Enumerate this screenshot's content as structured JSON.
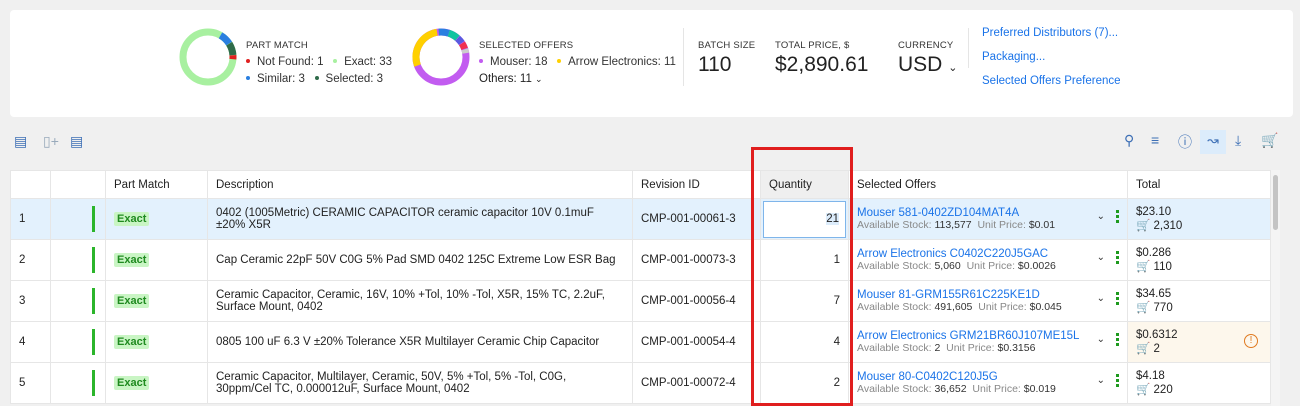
{
  "summary": {
    "part_match": {
      "title": "PART MATCH",
      "items": [
        {
          "label": "Not Found: 1",
          "color": "#e02020"
        },
        {
          "label": "Exact: 33",
          "color": "#a8f0a0"
        },
        {
          "label": "Similar: 3",
          "color": "#2a7fe0"
        },
        {
          "label": "Selected: 3",
          "color": "#2f6b4a"
        }
      ]
    },
    "selected_offers": {
      "title": "SELECTED OFFERS",
      "items": [
        {
          "label": "Mouser: 18",
          "color": "#c25cf0"
        },
        {
          "label": "Arrow Electronics: 11",
          "color": "#ffd000"
        }
      ],
      "others": "Others: 11"
    },
    "batch_size": {
      "label": "BATCH SIZE",
      "value": "110"
    },
    "total_price": {
      "label": "TOTAL PRICE, $",
      "value": "$2,890.61"
    },
    "currency": {
      "label": "CURRENCY",
      "value": "USD"
    },
    "links": [
      "Preferred Distributors (7)...",
      "Packaging...",
      "Selected Offers Preference"
    ]
  },
  "toolbar": {
    "left_icons": [
      "add-row-icon",
      "add-column-icon",
      "remove-row-icon"
    ],
    "right_icons": [
      "search-icon",
      "filter-sliders-icon",
      "info-icon",
      "chart-icon",
      "download-icon",
      "cart-icon"
    ]
  },
  "table": {
    "headers": [
      "",
      "",
      "Part Match",
      "Description",
      "Revision ID",
      "Quantity",
      "Selected Offers",
      "Total"
    ],
    "rows": [
      {
        "num": "1",
        "match": "Exact",
        "desc": "0402 (1005Metric) CERAMIC CAPACITOR ceramic capacitor 10V 0.1muF ±20% X5R",
        "rev": "CMP-001-00061-3",
        "qty": "21",
        "offer": "Mouser 581-0402ZD104MAT4A",
        "stock_label": "Available Stock:",
        "stock": "113,577",
        "price_label": "Unit Price:",
        "price": "$0.01",
        "total": "$23.10",
        "cart": "2,310"
      },
      {
        "num": "2",
        "match": "Exact",
        "desc": "Cap Ceramic 22pF 50V C0G 5% Pad SMD 0402 125C Extreme Low ESR Bag",
        "rev": "CMP-001-00073-3",
        "qty": "1",
        "offer": "Arrow Electronics C0402C220J5GAC",
        "stock_label": "Available Stock:",
        "stock": "5,060",
        "price_label": "Unit Price:",
        "price": "$0.0026",
        "total": "$0.286",
        "cart": "110"
      },
      {
        "num": "3",
        "match": "Exact",
        "desc": "Ceramic Capacitor, Ceramic, 16V, 10% +Tol, 10% -Tol, X5R, 15% TC, 2.2uF, Surface Mount, 0402",
        "rev": "CMP-001-00056-4",
        "qty": "7",
        "offer": "Mouser 81-GRM155R61C225KE1D",
        "stock_label": "Available Stock:",
        "stock": "491,605",
        "price_label": "Unit Price:",
        "price": "$0.045",
        "total": "$34.65",
        "cart": "770"
      },
      {
        "num": "4",
        "match": "Exact",
        "desc": "0805 100 uF 6.3 V ±20% Tolerance X5R Multilayer Ceramic Chip Capacitor",
        "rev": "CMP-001-00054-4",
        "qty": "4",
        "offer": "Arrow Electronics GRM21BR60J107ME15L",
        "stock_label": "Available Stock:",
        "stock": "2",
        "price_label": "Unit Price:",
        "price": "$0.3156",
        "total": "$0.6312",
        "cart": "2",
        "warning": true
      },
      {
        "num": "5",
        "match": "Exact",
        "desc": "Ceramic Capacitor, Multilayer, Ceramic, 50V, 5% +Tol, 5% -Tol, C0G, 30ppm/Cel TC, 0.000012uF, Surface Mount, 0402",
        "rev": "CMP-001-00072-4",
        "qty": "2",
        "offer": "Mouser 80-C0402C120J5G",
        "stock_label": "Available Stock:",
        "stock": "36,652",
        "price_label": "Unit Price:",
        "price": "$0.019",
        "total": "$4.18",
        "cart": "220"
      }
    ]
  }
}
